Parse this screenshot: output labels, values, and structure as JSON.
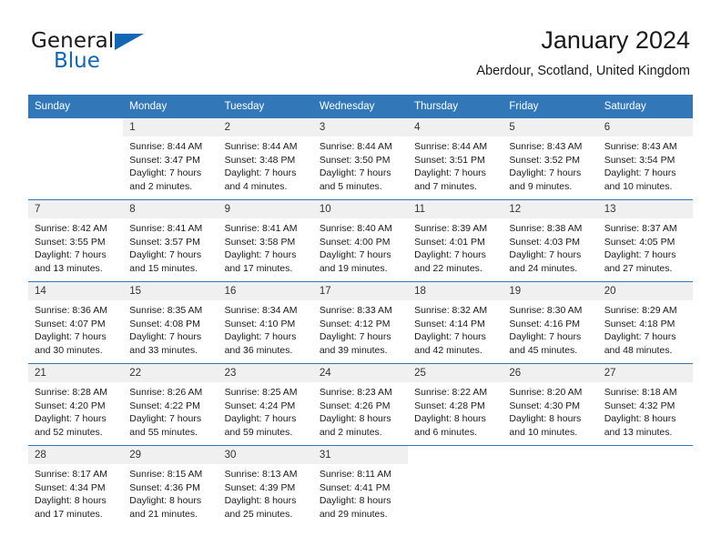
{
  "brand": {
    "name_part1": "General",
    "name_part2": "Blue",
    "accent_color": "#1266b4"
  },
  "header": {
    "title": "January 2024",
    "subtitle": "Aberdour, Scotland, United Kingdom"
  },
  "calendar": {
    "header_bg": "#3278b8",
    "daynum_bg": "#f0f0f0",
    "weekdays": [
      "Sunday",
      "Monday",
      "Tuesday",
      "Wednesday",
      "Thursday",
      "Friday",
      "Saturday"
    ],
    "weeks": [
      [
        {
          "day": "",
          "empty": true,
          "sunrise": "",
          "sunset": "",
          "daylight1": "",
          "daylight2": ""
        },
        {
          "day": "1",
          "sunrise": "Sunrise: 8:44 AM",
          "sunset": "Sunset: 3:47 PM",
          "daylight1": "Daylight: 7 hours",
          "daylight2": "and 2 minutes."
        },
        {
          "day": "2",
          "sunrise": "Sunrise: 8:44 AM",
          "sunset": "Sunset: 3:48 PM",
          "daylight1": "Daylight: 7 hours",
          "daylight2": "and 4 minutes."
        },
        {
          "day": "3",
          "sunrise": "Sunrise: 8:44 AM",
          "sunset": "Sunset: 3:50 PM",
          "daylight1": "Daylight: 7 hours",
          "daylight2": "and 5 minutes."
        },
        {
          "day": "4",
          "sunrise": "Sunrise: 8:44 AM",
          "sunset": "Sunset: 3:51 PM",
          "daylight1": "Daylight: 7 hours",
          "daylight2": "and 7 minutes."
        },
        {
          "day": "5",
          "sunrise": "Sunrise: 8:43 AM",
          "sunset": "Sunset: 3:52 PM",
          "daylight1": "Daylight: 7 hours",
          "daylight2": "and 9 minutes."
        },
        {
          "day": "6",
          "sunrise": "Sunrise: 8:43 AM",
          "sunset": "Sunset: 3:54 PM",
          "daylight1": "Daylight: 7 hours",
          "daylight2": "and 10 minutes."
        }
      ],
      [
        {
          "day": "7",
          "sunrise": "Sunrise: 8:42 AM",
          "sunset": "Sunset: 3:55 PM",
          "daylight1": "Daylight: 7 hours",
          "daylight2": "and 13 minutes."
        },
        {
          "day": "8",
          "sunrise": "Sunrise: 8:41 AM",
          "sunset": "Sunset: 3:57 PM",
          "daylight1": "Daylight: 7 hours",
          "daylight2": "and 15 minutes."
        },
        {
          "day": "9",
          "sunrise": "Sunrise: 8:41 AM",
          "sunset": "Sunset: 3:58 PM",
          "daylight1": "Daylight: 7 hours",
          "daylight2": "and 17 minutes."
        },
        {
          "day": "10",
          "sunrise": "Sunrise: 8:40 AM",
          "sunset": "Sunset: 4:00 PM",
          "daylight1": "Daylight: 7 hours",
          "daylight2": "and 19 minutes."
        },
        {
          "day": "11",
          "sunrise": "Sunrise: 8:39 AM",
          "sunset": "Sunset: 4:01 PM",
          "daylight1": "Daylight: 7 hours",
          "daylight2": "and 22 minutes."
        },
        {
          "day": "12",
          "sunrise": "Sunrise: 8:38 AM",
          "sunset": "Sunset: 4:03 PM",
          "daylight1": "Daylight: 7 hours",
          "daylight2": "and 24 minutes."
        },
        {
          "day": "13",
          "sunrise": "Sunrise: 8:37 AM",
          "sunset": "Sunset: 4:05 PM",
          "daylight1": "Daylight: 7 hours",
          "daylight2": "and 27 minutes."
        }
      ],
      [
        {
          "day": "14",
          "sunrise": "Sunrise: 8:36 AM",
          "sunset": "Sunset: 4:07 PM",
          "daylight1": "Daylight: 7 hours",
          "daylight2": "and 30 minutes."
        },
        {
          "day": "15",
          "sunrise": "Sunrise: 8:35 AM",
          "sunset": "Sunset: 4:08 PM",
          "daylight1": "Daylight: 7 hours",
          "daylight2": "and 33 minutes."
        },
        {
          "day": "16",
          "sunrise": "Sunrise: 8:34 AM",
          "sunset": "Sunset: 4:10 PM",
          "daylight1": "Daylight: 7 hours",
          "daylight2": "and 36 minutes."
        },
        {
          "day": "17",
          "sunrise": "Sunrise: 8:33 AM",
          "sunset": "Sunset: 4:12 PM",
          "daylight1": "Daylight: 7 hours",
          "daylight2": "and 39 minutes."
        },
        {
          "day": "18",
          "sunrise": "Sunrise: 8:32 AM",
          "sunset": "Sunset: 4:14 PM",
          "daylight1": "Daylight: 7 hours",
          "daylight2": "and 42 minutes."
        },
        {
          "day": "19",
          "sunrise": "Sunrise: 8:30 AM",
          "sunset": "Sunset: 4:16 PM",
          "daylight1": "Daylight: 7 hours",
          "daylight2": "and 45 minutes."
        },
        {
          "day": "20",
          "sunrise": "Sunrise: 8:29 AM",
          "sunset": "Sunset: 4:18 PM",
          "daylight1": "Daylight: 7 hours",
          "daylight2": "and 48 minutes."
        }
      ],
      [
        {
          "day": "21",
          "sunrise": "Sunrise: 8:28 AM",
          "sunset": "Sunset: 4:20 PM",
          "daylight1": "Daylight: 7 hours",
          "daylight2": "and 52 minutes."
        },
        {
          "day": "22",
          "sunrise": "Sunrise: 8:26 AM",
          "sunset": "Sunset: 4:22 PM",
          "daylight1": "Daylight: 7 hours",
          "daylight2": "and 55 minutes."
        },
        {
          "day": "23",
          "sunrise": "Sunrise: 8:25 AM",
          "sunset": "Sunset: 4:24 PM",
          "daylight1": "Daylight: 7 hours",
          "daylight2": "and 59 minutes."
        },
        {
          "day": "24",
          "sunrise": "Sunrise: 8:23 AM",
          "sunset": "Sunset: 4:26 PM",
          "daylight1": "Daylight: 8 hours",
          "daylight2": "and 2 minutes."
        },
        {
          "day": "25",
          "sunrise": "Sunrise: 8:22 AM",
          "sunset": "Sunset: 4:28 PM",
          "daylight1": "Daylight: 8 hours",
          "daylight2": "and 6 minutes."
        },
        {
          "day": "26",
          "sunrise": "Sunrise: 8:20 AM",
          "sunset": "Sunset: 4:30 PM",
          "daylight1": "Daylight: 8 hours",
          "daylight2": "and 10 minutes."
        },
        {
          "day": "27",
          "sunrise": "Sunrise: 8:18 AM",
          "sunset": "Sunset: 4:32 PM",
          "daylight1": "Daylight: 8 hours",
          "daylight2": "and 13 minutes."
        }
      ],
      [
        {
          "day": "28",
          "sunrise": "Sunrise: 8:17 AM",
          "sunset": "Sunset: 4:34 PM",
          "daylight1": "Daylight: 8 hours",
          "daylight2": "and 17 minutes."
        },
        {
          "day": "29",
          "sunrise": "Sunrise: 8:15 AM",
          "sunset": "Sunset: 4:36 PM",
          "daylight1": "Daylight: 8 hours",
          "daylight2": "and 21 minutes."
        },
        {
          "day": "30",
          "sunrise": "Sunrise: 8:13 AM",
          "sunset": "Sunset: 4:39 PM",
          "daylight1": "Daylight: 8 hours",
          "daylight2": "and 25 minutes."
        },
        {
          "day": "31",
          "sunrise": "Sunrise: 8:11 AM",
          "sunset": "Sunset: 4:41 PM",
          "daylight1": "Daylight: 8 hours",
          "daylight2": "and 29 minutes."
        },
        {
          "day": "",
          "empty": true,
          "sunrise": "",
          "sunset": "",
          "daylight1": "",
          "daylight2": ""
        },
        {
          "day": "",
          "empty": true,
          "sunrise": "",
          "sunset": "",
          "daylight1": "",
          "daylight2": ""
        },
        {
          "day": "",
          "empty": true,
          "sunrise": "",
          "sunset": "",
          "daylight1": "",
          "daylight2": ""
        }
      ]
    ]
  }
}
